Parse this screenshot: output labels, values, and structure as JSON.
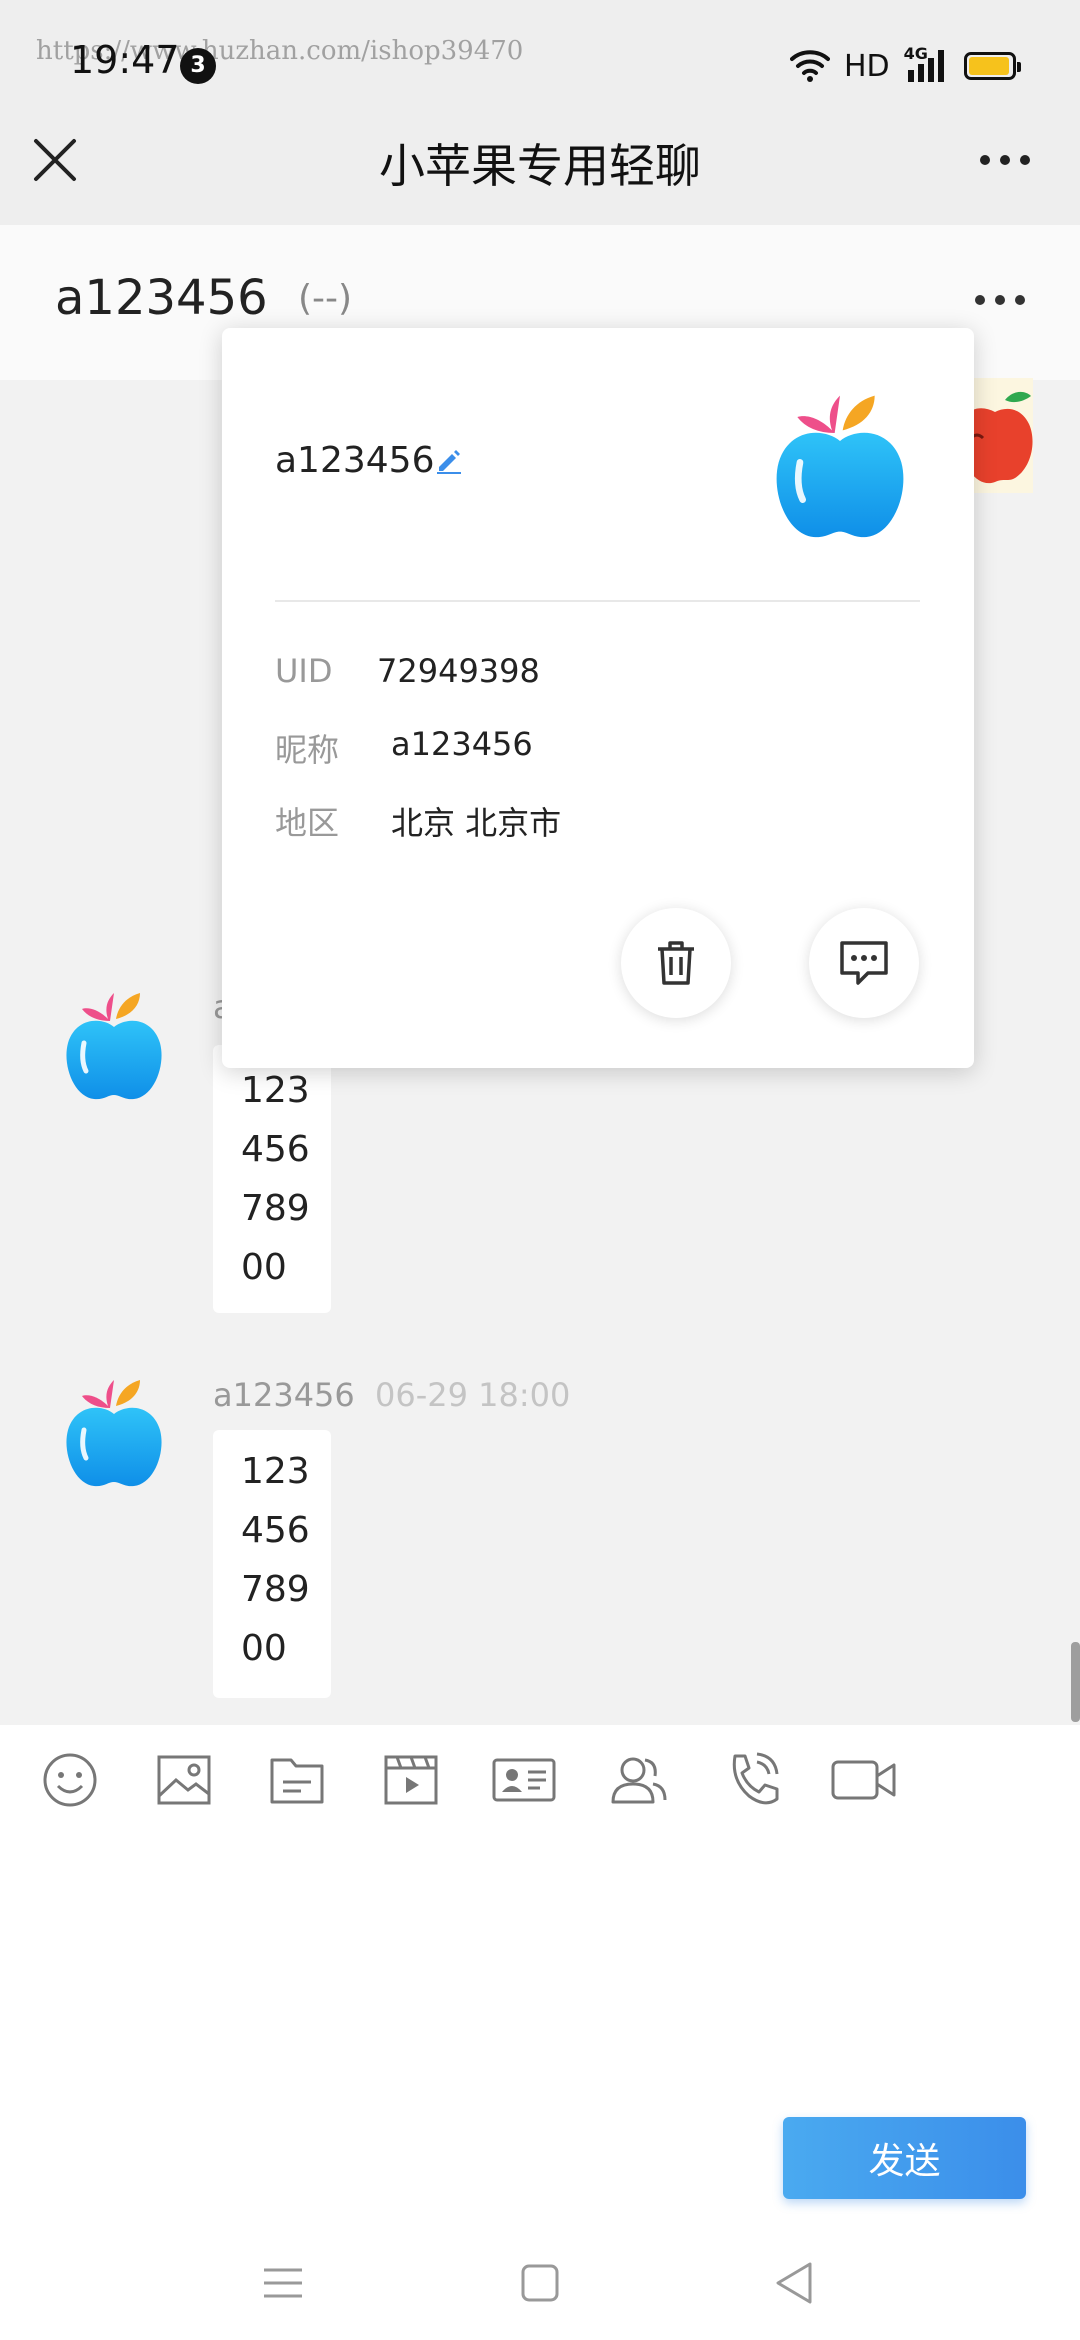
{
  "status_bar": {
    "time": "19:47",
    "notification_count": "3",
    "network": "HD",
    "network_gen": "4G",
    "watermark": "https://www.huzhan.com/ishop39470"
  },
  "app_bar": {
    "title": "小苹果专用轻聊"
  },
  "chat_header": {
    "name": "a123456",
    "status": "(--)"
  },
  "profile_popup": {
    "name": "a123456",
    "rows": [
      {
        "label": "UID",
        "value": "72949398"
      },
      {
        "label": "昵称",
        "value": "a123456"
      },
      {
        "label": "地区",
        "value": "北京 北京市"
      }
    ]
  },
  "messages": [
    {
      "sender": "a",
      "time": "",
      "lines": [
        "123",
        "456",
        "789",
        "00"
      ]
    },
    {
      "sender": "a123456",
      "time": "06-29 18:00",
      "lines": [
        "123",
        "456",
        "789",
        "00"
      ]
    }
  ],
  "toolbar": {
    "icons": [
      "emoji-icon",
      "image-icon",
      "folder-icon",
      "video-file-icon",
      "contact-card-icon",
      "group-icon",
      "phone-call-icon",
      "video-call-icon"
    ]
  },
  "composer": {
    "send_label": "发送"
  },
  "colors": {
    "accent": "#3b8eea",
    "apple_blue": "#1aa9f2",
    "leaf_pink": "#ee4f8a",
    "leaf_orange": "#f5a623"
  }
}
